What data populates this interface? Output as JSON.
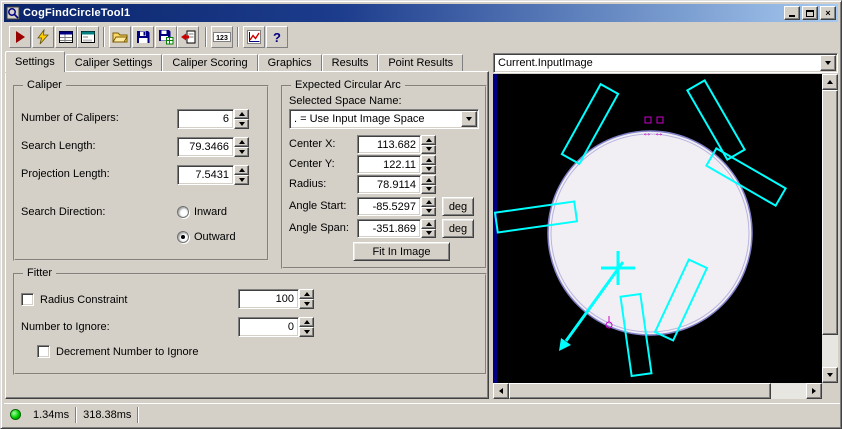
{
  "window": {
    "title": "CogFindCircleTool1"
  },
  "toolbar": {
    "icons": [
      "run-icon",
      "live-run-icon",
      "show-results-icon",
      "show-controls-icon",
      "open-icon",
      "save-icon",
      "save-image-icon",
      "import-icon",
      "numeric-icon",
      "chart-icon",
      "help-icon"
    ],
    "numeric_label": "123",
    "help_label": "?"
  },
  "tabs": [
    "Settings",
    "Caliper Settings",
    "Caliper Scoring",
    "Graphics",
    "Results",
    "Point Results"
  ],
  "active_tab": "Settings",
  "caliper_group": {
    "legend": "Caliper",
    "number_of_calipers_label": "Number of Calipers:",
    "number_of_calipers_value": "6",
    "search_length_label": "Search Length:",
    "search_length_value": "79.3466",
    "projection_length_label": "Projection Length:",
    "projection_length_value": "7.5431",
    "search_direction_label": "Search Direction:",
    "inward_label": "Inward",
    "outward_label": "Outward",
    "selected_direction": "Outward"
  },
  "arc_group": {
    "legend": "Expected Circular Arc",
    "space_name_label": "Selected Space Name:",
    "space_name_value": ". = Use Input Image Space",
    "center_x_label": "Center X:",
    "center_x_value": "113.682",
    "center_y_label": "Center Y:",
    "center_y_value": "122.11",
    "radius_label": "Radius:",
    "radius_value": "78.9114",
    "angle_start_label": "Angle Start:",
    "angle_start_value": "-85.5297",
    "angle_span_label": "Angle Span:",
    "angle_span_value": "-351.869",
    "deg_label": "deg",
    "fit_in_image_label": "Fit In Image"
  },
  "fitter_group": {
    "legend": "Fitter",
    "radius_constraint_label": "Radius Constraint",
    "radius_constraint_checked": false,
    "radius_constraint_value": "100",
    "number_to_ignore_label": "Number to Ignore:",
    "number_to_ignore_value": "0",
    "decrement_label": "Decrement Number to Ignore",
    "decrement_checked": false
  },
  "image_panel": {
    "combo_value": "Current.InputImage"
  },
  "status_bar": {
    "run_time": "1.34ms",
    "total_time": "318.38ms"
  },
  "colors": {
    "caliper_graphics": "#00ffff",
    "marker": "#cc00cc",
    "circle_fill": "#f2eff4",
    "circle_ring": "#8080c8",
    "image_background": "#000000",
    "titlebar_start": "#0a246a",
    "titlebar_end": "#a6caf0",
    "chrome": "#d4d0c8"
  }
}
